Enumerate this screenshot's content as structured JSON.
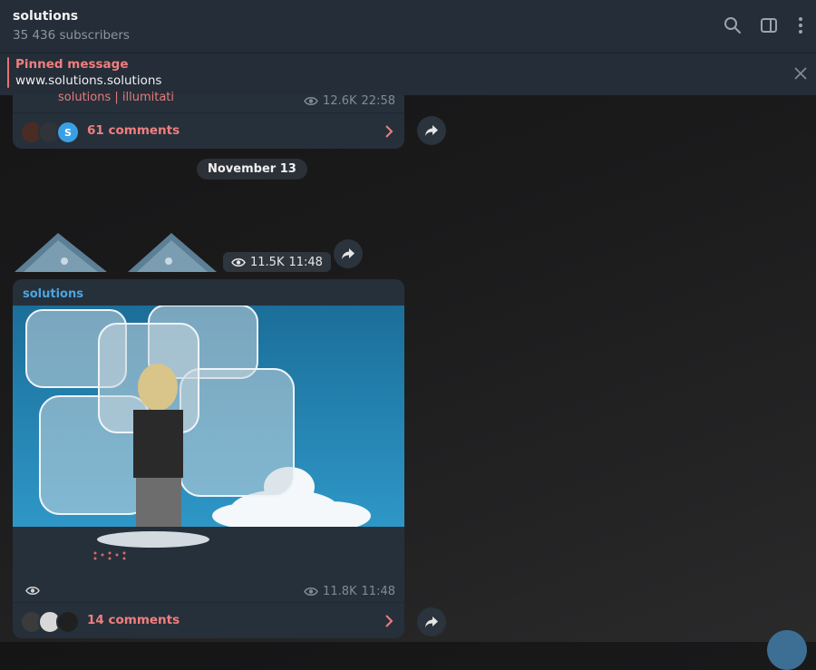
{
  "channel": {
    "title": "solutions",
    "subscribers": "35 436 subscribers"
  },
  "pinned": {
    "label": "Pinned message",
    "text": "www.solutions.solutions"
  },
  "post1": {
    "author": "solutions | illumitati",
    "views": "12.6K",
    "time": "22:58",
    "comments": "61 comments"
  },
  "date_separator": "November 13",
  "album": {
    "views": "11.5K",
    "time": "11:48"
  },
  "post2": {
    "sender": "solutions",
    "views": "11.8K",
    "time": "11:48",
    "comments": "14 comments"
  },
  "icons": [
    "search-icon",
    "sidebar-toggle-icon",
    "more-vertical-icon",
    "close-icon",
    "eye-icon",
    "chevron-right-icon",
    "share-icon"
  ],
  "colors": {
    "accent_red": "#f07f7f",
    "sender_blue": "#49a6e0",
    "panel": "#242d38",
    "bubble": "#26303b"
  }
}
